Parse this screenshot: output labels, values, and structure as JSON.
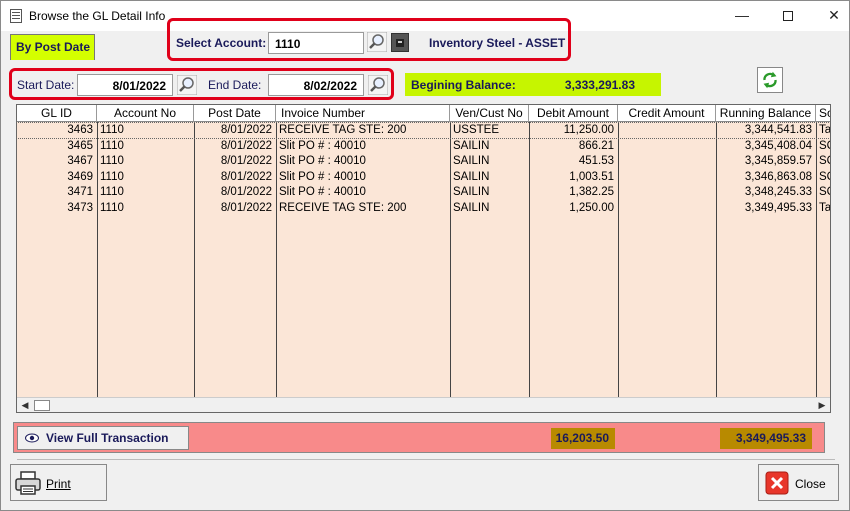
{
  "window": {
    "title": "Browse the GL Detail Info"
  },
  "tab": {
    "label": "By Post Date"
  },
  "account": {
    "label": "Select Account:",
    "value": "1110",
    "description": "Inventory Steel - ASSET"
  },
  "dates": {
    "start_label": "Start Date:",
    "start_value": "8/01/2022",
    "end_label": "End Date:",
    "end_value": "8/02/2022"
  },
  "balance": {
    "label": "Begining Balance:",
    "value": "3,333,291.83"
  },
  "grid": {
    "columns": [
      "GL ID",
      "Account No",
      "Post Date",
      "Invoice Number",
      "Ven/Cust No",
      "Debit Amount",
      "Credit Amount",
      "Running Balance",
      "So"
    ],
    "rows": [
      [
        "3463",
        "1110",
        "8/01/2022",
        "RECEIVE TAG STE: 200",
        "USSTEE",
        "11,250.00",
        "",
        "3,344,541.83",
        "Ta"
      ],
      [
        "3465",
        "1110",
        "8/01/2022",
        "Slit PO # : 40010",
        "SAILIN",
        "866.21",
        "",
        "3,345,408.04",
        "SC"
      ],
      [
        "3467",
        "1110",
        "8/01/2022",
        "Slit PO # : 40010",
        "SAILIN",
        "451.53",
        "",
        "3,345,859.57",
        "SC"
      ],
      [
        "3469",
        "1110",
        "8/01/2022",
        "Slit PO # : 40010",
        "SAILIN",
        "1,003.51",
        "",
        "3,346,863.08",
        "SC"
      ],
      [
        "3471",
        "1110",
        "8/01/2022",
        "Slit PO # : 40010",
        "SAILIN",
        "1,382.25",
        "",
        "3,348,245.33",
        "SC"
      ],
      [
        "3473",
        "1110",
        "8/01/2022",
        "RECEIVE TAG STE: 200",
        "SAILIN",
        "1,250.00",
        "",
        "3,349,495.33",
        "Ta"
      ]
    ]
  },
  "footer": {
    "view_label": "View Full Transaction",
    "debit_total": "16,203.50",
    "running_total": "3,349,495.33"
  },
  "buttons": {
    "print": "Print",
    "close": "Close"
  },
  "icons": {
    "search": "magnifier-icon",
    "lookup": "box-icon",
    "refresh": "refresh-icon",
    "eye": "eye-icon",
    "printer": "printer-icon",
    "close": "close-x-icon"
  }
}
